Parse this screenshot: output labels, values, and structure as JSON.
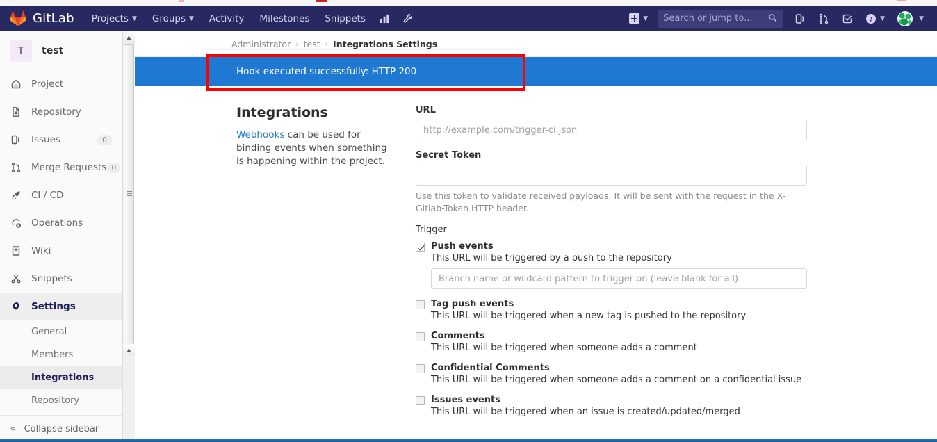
{
  "chrome": {
    "strip_present": true
  },
  "navbar": {
    "brand": "GitLab",
    "brand_icon": "gitlab-fox-logo",
    "links": [
      {
        "label": "Projects",
        "has_caret": true
      },
      {
        "label": "Groups",
        "has_caret": true
      },
      {
        "label": "Activity",
        "has_caret": false
      },
      {
        "label": "Milestones",
        "has_caret": false
      },
      {
        "label": "Snippets",
        "has_caret": false
      }
    ],
    "icon_links": [
      {
        "name": "analytics-chart-icon"
      },
      {
        "name": "wrench-admin-icon"
      }
    ],
    "right": {
      "new_label": "",
      "search_placeholder": "Search or jump to...",
      "search_value": "",
      "icons": [
        {
          "name": "issues-icon"
        },
        {
          "name": "merge-requests-icon"
        },
        {
          "name": "todos-icon"
        },
        {
          "name": "help-icon"
        }
      ],
      "avatar_name": "user-avatar"
    }
  },
  "sidebar": {
    "project": {
      "initial": "T",
      "name": "test"
    },
    "items": [
      {
        "label": "Project",
        "icon": "home-icon",
        "badge": ""
      },
      {
        "label": "Repository",
        "icon": "document-icon",
        "badge": ""
      },
      {
        "label": "Issues",
        "icon": "issues-icon",
        "badge": "0"
      },
      {
        "label": "Merge Requests",
        "icon": "merge-requests-icon",
        "badge": "0"
      },
      {
        "label": "CI / CD",
        "icon": "rocket-icon",
        "badge": ""
      },
      {
        "label": "Operations",
        "icon": "operations-icon",
        "badge": ""
      },
      {
        "label": "Wiki",
        "icon": "book-icon",
        "badge": ""
      },
      {
        "label": "Snippets",
        "icon": "scissors-icon",
        "badge": ""
      }
    ],
    "settings": {
      "label": "Settings",
      "icon": "gear-icon"
    },
    "settings_sub": [
      {
        "label": "General",
        "selected": false
      },
      {
        "label": "Members",
        "selected": false
      },
      {
        "label": "Integrations",
        "selected": true
      },
      {
        "label": "Repository",
        "selected": false
      }
    ],
    "collapse": {
      "label": "Collapse sidebar",
      "icon": "double-chevron-left-icon"
    }
  },
  "breadcrumb": {
    "items": [
      "Administrator",
      "test"
    ],
    "current": "Integrations Settings",
    "separator": "›"
  },
  "alert": {
    "message": "Hook executed successfully: HTTP 200",
    "background": "#1f78d1",
    "text_color": "#ffffff"
  },
  "annotation": {
    "color": "#ff0000",
    "shape": "rectangle"
  },
  "intro": {
    "heading": "Integrations",
    "link_text": "Webhooks",
    "body": " can be used for binding events when something is happening within the project."
  },
  "form": {
    "url": {
      "label": "URL",
      "placeholder": "http://example.com/trigger-ci.json",
      "value": ""
    },
    "secret_token": {
      "label": "Secret Token",
      "placeholder": "",
      "value": "",
      "help": "Use this token to validate received payloads. It will be sent with the request in the X-Gitlab-Token HTTP header."
    },
    "trigger_label": "Trigger",
    "branch_input": {
      "placeholder": "Branch name or wildcard pattern to trigger on (leave blank for all)",
      "value": ""
    },
    "triggers": [
      {
        "label": "Push events",
        "description": "This URL will be triggered by a push to the repository",
        "checked": true,
        "has_branch_input": true
      },
      {
        "label": "Tag push events",
        "description": "This URL will be triggered when a new tag is pushed to the repository",
        "checked": false,
        "has_branch_input": false
      },
      {
        "label": "Comments",
        "description": "This URL will be triggered when someone adds a comment",
        "checked": false,
        "has_branch_input": false
      },
      {
        "label": "Confidential Comments",
        "description": "This URL will be triggered when someone adds a comment on a confidential issue",
        "checked": false,
        "has_branch_input": false
      },
      {
        "label": "Issues events",
        "description": "This URL will be triggered when an issue is created/updated/merged",
        "checked": false,
        "has_branch_input": false
      }
    ]
  },
  "scrollbar": {
    "up_arrow": "▲",
    "down_arrow": "▲"
  }
}
